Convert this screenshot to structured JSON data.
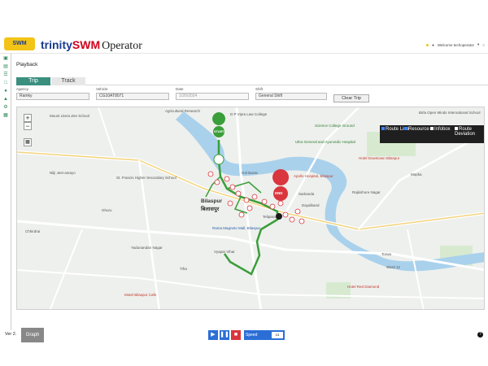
{
  "app": {
    "logo_text": "SWM",
    "brand_part1": "trinity",
    "brand_part2": "SWM",
    "brand_part3": "Operator",
    "welcome": "Welcome techoperator",
    "page_title": "Playback"
  },
  "tabs": [
    {
      "label": "Trip",
      "active": true
    },
    {
      "label": "Track",
      "active": false
    }
  ],
  "filters": {
    "agency_label": "Agency",
    "agency_value": "Ramky",
    "vehicle_label": "Vehicle",
    "vehicle_value": "CG10AT8071",
    "date_label": "Date",
    "date_value": "1/26/2024",
    "shift_label": "Shift",
    "shift_value": "General Shift",
    "clear_label": "Clear Trip"
  },
  "legend": {
    "route_line": "Route Line",
    "resource": "Resource",
    "infobox": "Infobox",
    "route_deviation": "Route Deviation"
  },
  "map": {
    "labels": [
      {
        "text": "Bilaspur",
        "cls": "big"
      },
      {
        "text": "बिलासपुर",
        "cls": "big"
      },
      {
        "text": "Dayalband",
        "cls": ""
      },
      {
        "text": "Rajkishore Nagar",
        "cls": ""
      },
      {
        "text": "Chhirdrai",
        "cls": ""
      },
      {
        "text": "Mopka",
        "cls": ""
      },
      {
        "text": "Ghuru",
        "cls": ""
      },
      {
        "text": "Tifra",
        "cls": ""
      },
      {
        "text": "Vyapar Vihar",
        "cls": ""
      },
      {
        "text": "Gol Bazar",
        "cls": ""
      },
      {
        "text": "Apollo Hospital, Bilaspur",
        "cls": "red"
      },
      {
        "text": "Rama Magneto Mall, Bilaspur",
        "cls": "blue"
      },
      {
        "text": "Motel Bilaspur Cafe",
        "cls": "red"
      },
      {
        "text": "Hotel Red Diamond",
        "cls": "red"
      },
      {
        "text": "Hotel Downtown Bilaspur",
        "cls": "red"
      },
      {
        "text": "Ultra General and Ayurvedic Hospital",
        "cls": "green"
      },
      {
        "text": "Science College Ground",
        "cls": "green"
      },
      {
        "text": "Ward 12",
        "cls": ""
      },
      {
        "text": "Torwa",
        "cls": ""
      },
      {
        "text": "Birla Open Minds International School",
        "cls": ""
      },
      {
        "text": "Agricultural Research",
        "cls": ""
      },
      {
        "text": "D P Vipra Law College",
        "cls": ""
      },
      {
        "text": "Mount Litera Zee School",
        "cls": ""
      },
      {
        "text": "Nilji Jeet asrayo",
        "cls": ""
      },
      {
        "text": "St. Francis Higher Secondary School",
        "cls": ""
      },
      {
        "text": "Yadunandan Nagar",
        "cls": ""
      },
      {
        "text": "Sarkanda",
        "cls": ""
      },
      {
        "text": "Telipara",
        "cls": ""
      }
    ],
    "start_label": "START",
    "end_label": "END"
  },
  "bottom": {
    "version": "Ver 2.",
    "graph": "Graph",
    "speed_label": "Speed",
    "speed_value": "x1"
  }
}
